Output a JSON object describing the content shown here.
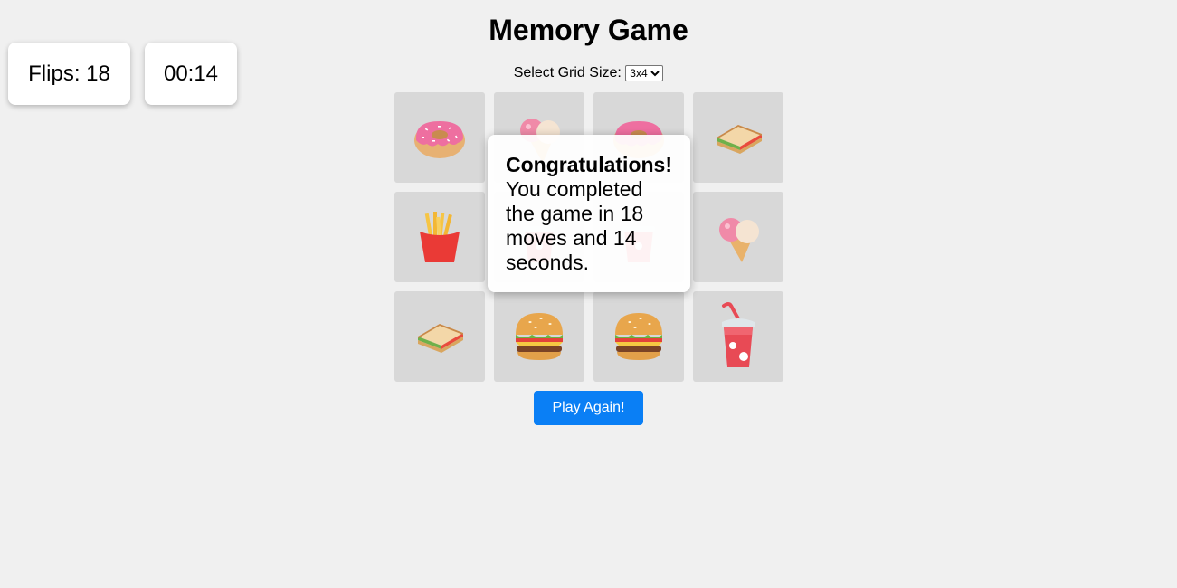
{
  "title": "Memory Game",
  "stats": {
    "flips_label": "Flips: 18",
    "timer": "00:14"
  },
  "grid_size": {
    "label": "Select Grid Size:",
    "selected": "3x4"
  },
  "cards": [
    {
      "icon": "donut-icon"
    },
    {
      "icon": "ice-cream-icon"
    },
    {
      "icon": "donut-icon"
    },
    {
      "icon": "sandwich-icon"
    },
    {
      "icon": "fries-icon"
    },
    {
      "icon": "drink-cup-icon"
    },
    {
      "icon": "drink-cup-icon"
    },
    {
      "icon": "ice-cream-icon"
    },
    {
      "icon": "sandwich-icon"
    },
    {
      "icon": "burger-icon"
    },
    {
      "icon": "burger-icon"
    },
    {
      "icon": "drink-cup-icon"
    }
  ],
  "modal": {
    "heading": "Congratulations!",
    "message": "You completed the game in 18 moves and 14 seconds."
  },
  "play_again_label": "Play Again!",
  "colors": {
    "background": "#f0f0f0",
    "card": "#d8d8d8",
    "button": "#0a7ff5"
  }
}
